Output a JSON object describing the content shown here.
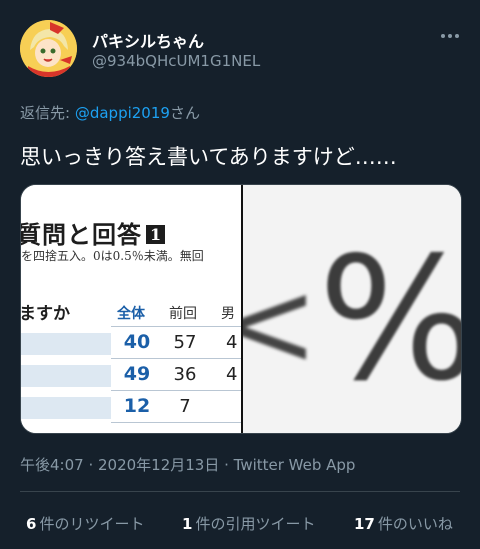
{
  "author": {
    "display_name": "パキシルちゃん",
    "handle": "@934bQHcUM1G1NEL",
    "avatar_icon": "anime-girl-avatar"
  },
  "reply": {
    "prefix": "返信先: ",
    "mention": "@dappi2019",
    "suffix": "さん"
  },
  "tweet": {
    "text": "思いっきり答え書いてありますけど……"
  },
  "media": {
    "title": "質問と回答",
    "title_number": "1",
    "note": "を四捨五入。0は0.5％未満。無回",
    "question": "ますか",
    "columns": {
      "total": "全体",
      "previous": "前回",
      "male": "男"
    },
    "rows": [
      {
        "total": "40",
        "previous": "57",
        "male": "4"
      },
      {
        "total": "49",
        "previous": "36",
        "male": "4"
      },
      {
        "total": "12",
        "previous": "7",
        "male": ""
      }
    ],
    "zoom_symbol": "%",
    "zoom_bracket": "<"
  },
  "meta": {
    "timestamp": "午後4:07 · 2020年12月13日 · Twitter Web App"
  },
  "stats": {
    "retweets_count": "6",
    "retweets_label": "件のリツイート",
    "quotes_count": "1",
    "quotes_label": "件の引用ツイート",
    "likes_count": "17",
    "likes_label": "件のいいね"
  },
  "colors": {
    "background": "#15202b",
    "secondary_text": "#8899a6",
    "link": "#1da1f2",
    "border": "#38444d"
  }
}
